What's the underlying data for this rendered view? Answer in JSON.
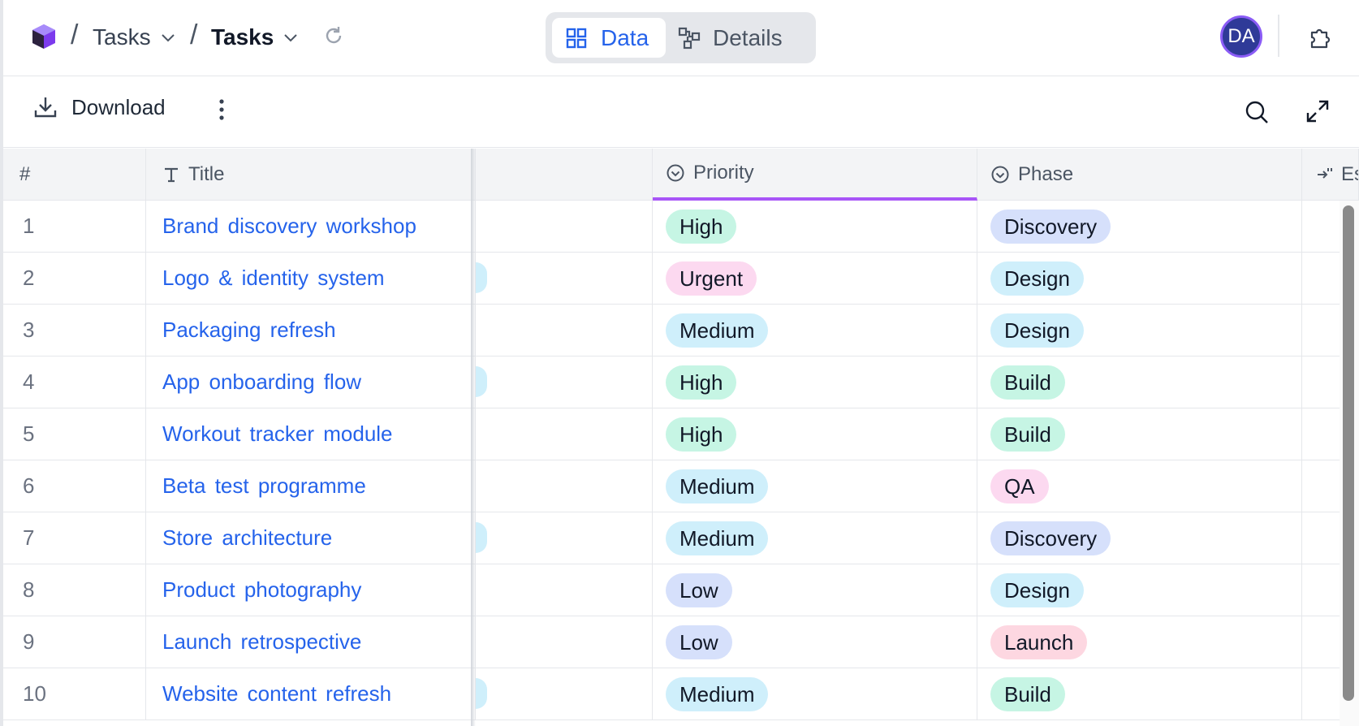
{
  "breadcrumb": {
    "workspace_label": "Tasks",
    "table_label": "Tasks"
  },
  "view_toggle": {
    "data_label": "Data",
    "details_label": "Details",
    "active": "Data"
  },
  "user": {
    "initials": "DA"
  },
  "toolbar": {
    "download_label": "Download"
  },
  "columns": {
    "number": "#",
    "title": "Title",
    "priority": "Priority",
    "phase": "Phase",
    "next_partial": "Es"
  },
  "rows": [
    {
      "n": "1",
      "title": "Brand discovery workshop",
      "priority": "High",
      "phase": "Discovery"
    },
    {
      "n": "2",
      "title": "Logo & identity system",
      "priority": "Urgent",
      "phase": "Design"
    },
    {
      "n": "3",
      "title": "Packaging refresh",
      "priority": "Medium",
      "phase": "Design"
    },
    {
      "n": "4",
      "title": "App onboarding flow",
      "priority": "High",
      "phase": "Build"
    },
    {
      "n": "5",
      "title": "Workout tracker module",
      "priority": "High",
      "phase": "Build"
    },
    {
      "n": "6",
      "title": "Beta test programme",
      "priority": "Medium",
      "phase": "QA"
    },
    {
      "n": "7",
      "title": "Store architecture",
      "priority": "Medium",
      "phase": "Discovery"
    },
    {
      "n": "8",
      "title": "Product photography",
      "priority": "Low",
      "phase": "Design"
    },
    {
      "n": "9",
      "title": "Launch retrospective",
      "priority": "Low",
      "phase": "Launch"
    },
    {
      "n": "10",
      "title": "Website content refresh",
      "priority": "Medium",
      "phase": "Build"
    }
  ],
  "colors": {
    "accent": "#2563eb",
    "sort_underline": "#a855f7",
    "priority": {
      "High": "#c6f5e4",
      "Urgent": "#fcd9f0",
      "Medium": "#cfeffb",
      "Low": "#d6e0fb"
    },
    "phase": {
      "Discovery": "#d6e0fb",
      "Design": "#cfeffb",
      "Build": "#c6f5e4",
      "QA": "#fcd9f0",
      "Launch": "#fdd7e1"
    }
  }
}
